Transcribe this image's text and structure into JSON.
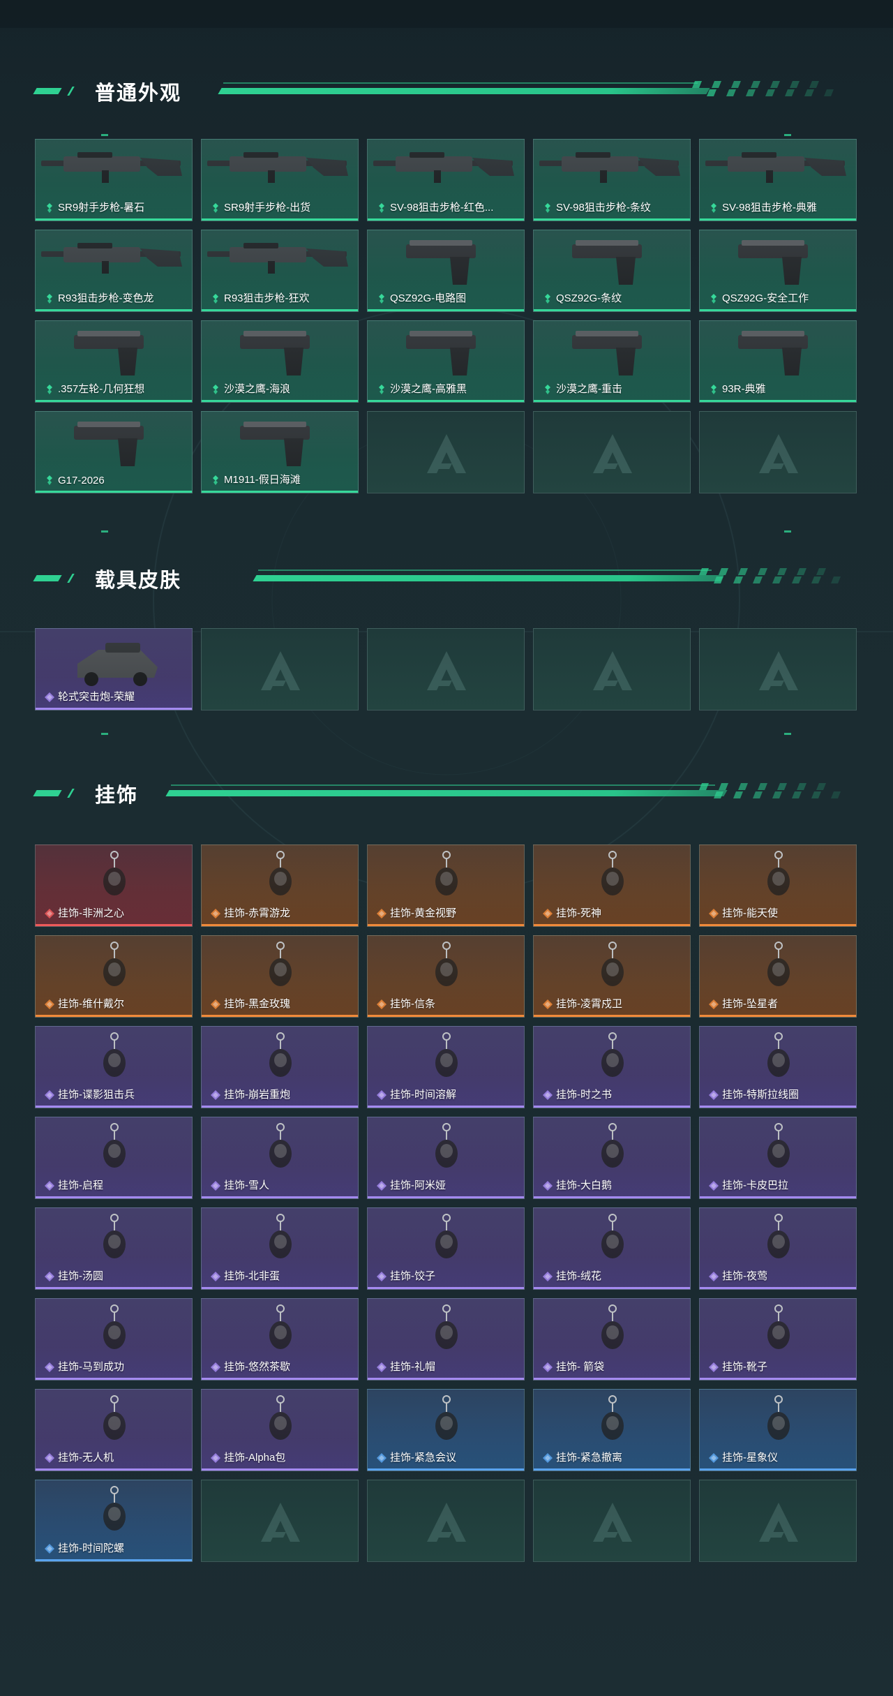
{
  "sections": {
    "skins": {
      "title": "普通外观",
      "items": [
        {
          "label": "SR9射手步枪-暑石",
          "rarity": "green",
          "icon": "rifle-icon"
        },
        {
          "label": "SR9射手步枪-出货",
          "rarity": "green",
          "icon": "rifle-icon"
        },
        {
          "label": "SV-98狙击步枪-红色...",
          "rarity": "green",
          "icon": "sniper-rifle-icon"
        },
        {
          "label": "SV-98狙击步枪-条纹",
          "rarity": "green",
          "icon": "sniper-rifle-icon"
        },
        {
          "label": "SV-98狙击步枪-典雅",
          "rarity": "green",
          "icon": "sniper-rifle-icon"
        },
        {
          "label": "R93狙击步枪-变色龙",
          "rarity": "green",
          "icon": "sniper-rifle-icon"
        },
        {
          "label": "R93狙击步枪-狂欢",
          "rarity": "green",
          "icon": "sniper-rifle-icon"
        },
        {
          "label": "QSZ92G-电路图",
          "rarity": "green",
          "icon": "pistol-icon"
        },
        {
          "label": "QSZ92G-条纹",
          "rarity": "green",
          "icon": "pistol-icon"
        },
        {
          "label": "QSZ92G-安全工作",
          "rarity": "green",
          "icon": "pistol-icon"
        },
        {
          "label": ".357左轮-几何狂想",
          "rarity": "green",
          "icon": "revolver-icon"
        },
        {
          "label": "沙漠之鹰-海浪",
          "rarity": "green",
          "icon": "pistol-icon"
        },
        {
          "label": "沙漠之鹰-高雅黑",
          "rarity": "green",
          "icon": "pistol-icon"
        },
        {
          "label": "沙漠之鹰-重击",
          "rarity": "green",
          "icon": "pistol-icon"
        },
        {
          "label": "93R-典雅",
          "rarity": "green",
          "icon": "pistol-icon"
        },
        {
          "label": "G17-2026",
          "rarity": "green",
          "icon": "pistol-icon"
        },
        {
          "label": "M1911-假日海滩",
          "rarity": "green",
          "icon": "pistol-icon"
        }
      ],
      "empty_slots": 3
    },
    "vehicles": {
      "title": "载具皮肤",
      "items": [
        {
          "label": "轮式突击炮-荣耀",
          "rarity": "purple",
          "icon": "vehicle-icon"
        }
      ],
      "empty_slots": 4
    },
    "charms": {
      "title": "挂饰",
      "items": [
        {
          "label": "挂饰-非洲之心",
          "rarity": "red",
          "icon": "charm-icon"
        },
        {
          "label": "挂饰-赤霄游龙",
          "rarity": "orange",
          "icon": "charm-icon"
        },
        {
          "label": "挂饰-黄金视野",
          "rarity": "orange",
          "icon": "charm-icon"
        },
        {
          "label": "挂饰-死神",
          "rarity": "orange",
          "icon": "charm-icon"
        },
        {
          "label": "挂饰-能天使",
          "rarity": "orange",
          "icon": "charm-icon"
        },
        {
          "label": "挂饰-维什戴尔",
          "rarity": "orange",
          "icon": "charm-icon"
        },
        {
          "label": "挂饰-黑金玫瑰",
          "rarity": "orange",
          "icon": "charm-icon"
        },
        {
          "label": "挂饰-信条",
          "rarity": "orange",
          "icon": "charm-icon"
        },
        {
          "label": "挂饰-凌霄戍卫",
          "rarity": "orange",
          "icon": "charm-icon"
        },
        {
          "label": "挂饰-坠星者",
          "rarity": "orange",
          "icon": "charm-icon"
        },
        {
          "label": "挂饰-谍影狙击兵",
          "rarity": "purple",
          "icon": "charm-icon"
        },
        {
          "label": "挂饰-崩岩重炮",
          "rarity": "purple",
          "icon": "charm-icon"
        },
        {
          "label": "挂饰-时间溶解",
          "rarity": "purple",
          "icon": "charm-icon"
        },
        {
          "label": "挂饰-时之书",
          "rarity": "purple",
          "icon": "charm-icon"
        },
        {
          "label": "挂饰-特斯拉线圈",
          "rarity": "purple",
          "icon": "charm-icon"
        },
        {
          "label": "挂饰-启程",
          "rarity": "purple",
          "icon": "charm-icon"
        },
        {
          "label": "挂饰-雪人",
          "rarity": "purple",
          "icon": "charm-icon"
        },
        {
          "label": "挂饰-阿米娅",
          "rarity": "purple",
          "icon": "charm-icon"
        },
        {
          "label": "挂饰-大白鹅",
          "rarity": "purple",
          "icon": "charm-icon"
        },
        {
          "label": "挂饰-卡皮巴拉",
          "rarity": "purple",
          "icon": "charm-icon"
        },
        {
          "label": "挂饰-汤圆",
          "rarity": "purple",
          "icon": "charm-icon"
        },
        {
          "label": "挂饰-北非蛋",
          "rarity": "purple",
          "icon": "charm-icon"
        },
        {
          "label": "挂饰-饺子",
          "rarity": "purple",
          "icon": "charm-icon"
        },
        {
          "label": "挂饰-绒花",
          "rarity": "purple",
          "icon": "charm-icon"
        },
        {
          "label": "挂饰-夜莺",
          "rarity": "purple",
          "icon": "charm-icon"
        },
        {
          "label": "挂饰-马到成功",
          "rarity": "purple",
          "icon": "charm-icon"
        },
        {
          "label": "挂饰-悠然茶歇",
          "rarity": "purple",
          "icon": "charm-icon"
        },
        {
          "label": "挂饰-礼帽",
          "rarity": "purple",
          "icon": "charm-icon"
        },
        {
          "label": "挂饰- 箭袋",
          "rarity": "purple",
          "icon": "charm-icon"
        },
        {
          "label": "挂饰-靴子",
          "rarity": "purple",
          "icon": "charm-icon"
        },
        {
          "label": "挂饰-无人机",
          "rarity": "purple",
          "icon": "charm-icon"
        },
        {
          "label": "挂饰-Alpha包",
          "rarity": "purple",
          "icon": "charm-icon"
        },
        {
          "label": "挂饰-紧急会议",
          "rarity": "blue",
          "icon": "charm-icon"
        },
        {
          "label": "挂饰-紧急撤离",
          "rarity": "blue",
          "icon": "charm-icon"
        },
        {
          "label": "挂饰-星象仪",
          "rarity": "blue",
          "icon": "charm-icon"
        },
        {
          "label": "挂饰-时间陀螺",
          "rarity": "blue",
          "icon": "charm-icon"
        }
      ],
      "empty_slots": 4
    }
  },
  "colors": {
    "accent": "#2fd192",
    "green": "#36d99a",
    "purple": "#a48af0",
    "orange": "#f08a3a",
    "red": "#ef5a5a",
    "blue": "#5aa4ef"
  }
}
